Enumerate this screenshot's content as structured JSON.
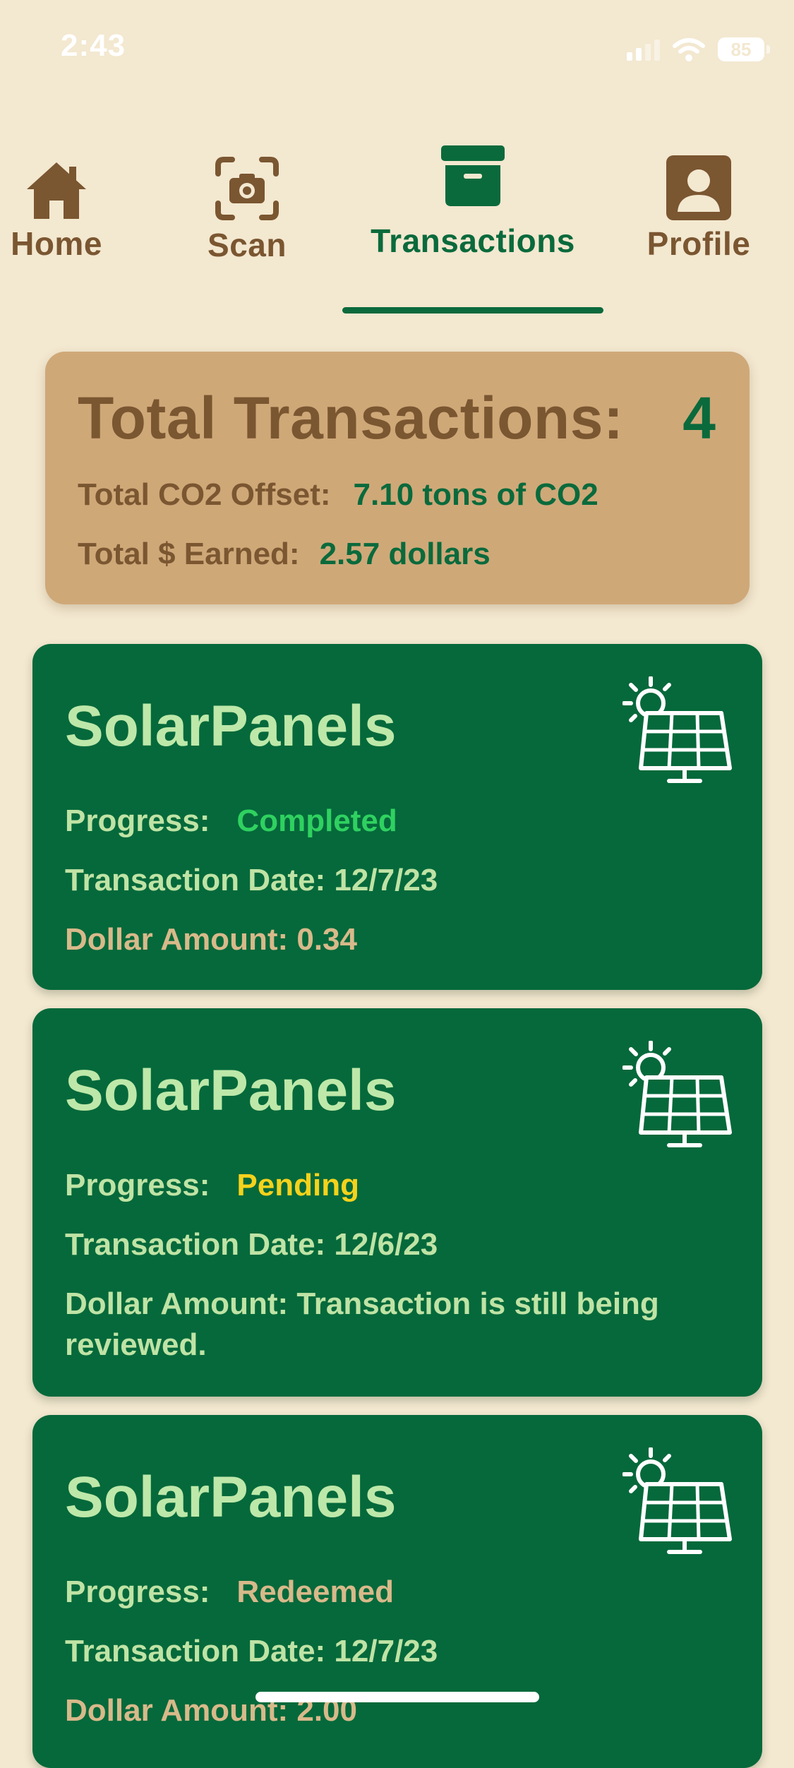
{
  "status_bar": {
    "time": "2:43",
    "battery": "85"
  },
  "tabs": [
    {
      "label": "Home",
      "icon": "home-icon"
    },
    {
      "label": "Scan",
      "icon": "camera-scan-icon"
    },
    {
      "label": "Transactions",
      "icon": "archive-box-icon",
      "active": true
    },
    {
      "label": "Profile",
      "icon": "person-icon"
    }
  ],
  "summary": {
    "title": "Total Transactions:",
    "count": "4",
    "co2_label": "Total CO2 Offset:",
    "co2_value": "7.10 tons of CO2",
    "earned_label": "Total $ Earned:",
    "earned_value": "2.57 dollars"
  },
  "transactions": [
    {
      "title": "SolarPanels",
      "progress_label": "Progress:",
      "progress": "Completed",
      "date_text": "Transaction Date: 12/7/23",
      "amount_text": "Dollar Amount: 0.34",
      "icon": "solar-panel-icon"
    },
    {
      "title": "SolarPanels",
      "progress_label": "Progress:",
      "progress": "Pending",
      "date_text": "Transaction Date: 12/6/23",
      "amount_text": "Dollar Amount: Transaction is still being reviewed.",
      "icon": "solar-panel-icon"
    },
    {
      "title": "SolarPanels",
      "progress_label": "Progress:",
      "progress": "Redeemed",
      "date_text": "Transaction Date: 12/7/23",
      "amount_text": "Dollar Amount: 2.00",
      "icon": "solar-panel-icon"
    }
  ],
  "colors": {
    "background": "#F3E8D0",
    "brown": "#7A5631",
    "green": "#05693B",
    "tan": "#CFA878",
    "completed": "#2FD160",
    "pending": "#F5D21C",
    "redeemed": "#D8B98A"
  }
}
